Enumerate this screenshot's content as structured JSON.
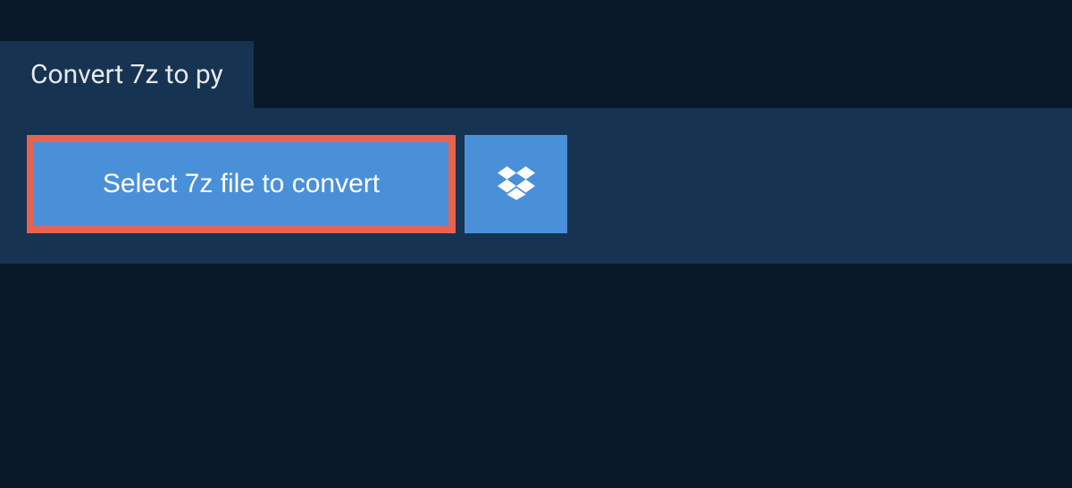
{
  "tab": {
    "label": "Convert 7z to py"
  },
  "panel": {
    "select_button_label": "Select 7z file to convert"
  },
  "colors": {
    "background": "#0a1929",
    "panel": "#163452",
    "button": "#4a90d9",
    "highlight_border": "#e8624e"
  }
}
